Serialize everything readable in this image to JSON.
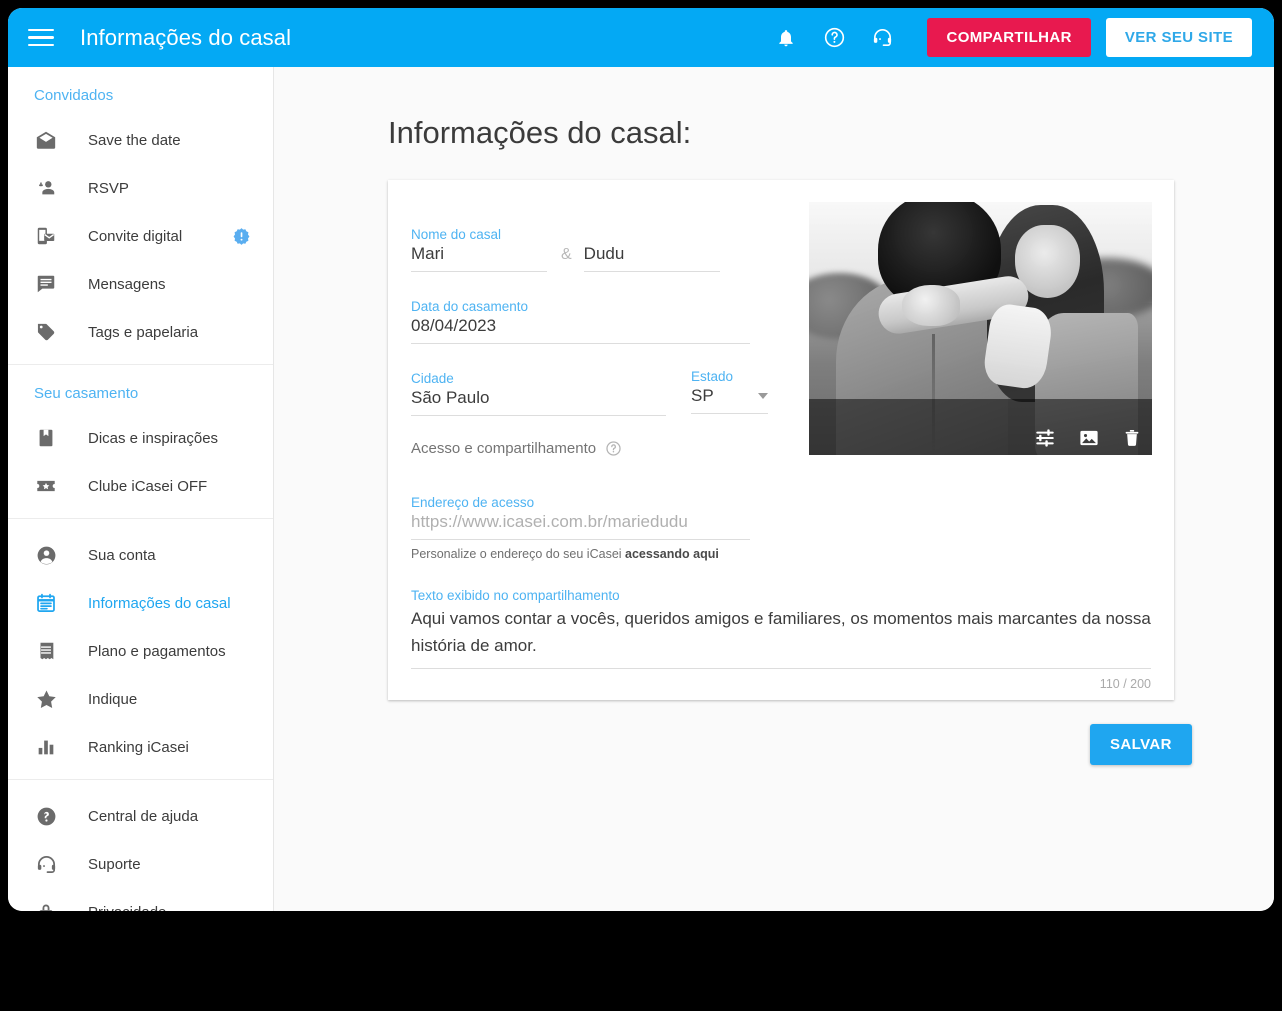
{
  "topbar": {
    "title": "Informações do casal",
    "menu_icon": "hamburger-menu-icon",
    "icons": [
      {
        "name": "notifications-bell-icon",
        "glyph": "bell"
      },
      {
        "name": "help-circle-icon",
        "glyph": "question"
      },
      {
        "name": "support-headset-icon",
        "glyph": "headset"
      }
    ],
    "share_label": "COMPARTILHAR",
    "site_label": "VER SEU SITE",
    "share_color": "#e8194f",
    "bar_color": "#04a9f4",
    "site_text_color": "#2fa8e8"
  },
  "sidebar": {
    "groups": [
      {
        "header": "Convidados",
        "items": [
          {
            "label": "Save the date",
            "icon": "mail-open-icon",
            "active": false,
            "badge": null
          },
          {
            "label": "RSVP",
            "icon": "person-add-icon",
            "active": false,
            "badge": null
          },
          {
            "label": "Convite digital",
            "icon": "mobile-invite-icon",
            "active": false,
            "badge": "!"
          },
          {
            "label": "Mensagens",
            "icon": "message-icon",
            "active": false,
            "badge": null
          },
          {
            "label": "Tags e papelaria",
            "icon": "tag-icon",
            "active": false,
            "badge": null
          }
        ]
      },
      {
        "header": "Seu casamento",
        "items": [
          {
            "label": "Dicas e inspirações",
            "icon": "bookmark-book-icon",
            "active": false,
            "badge": null
          },
          {
            "label": "Clube iCasei OFF",
            "icon": "ticket-star-icon",
            "active": false,
            "badge": null
          }
        ]
      },
      {
        "header": "",
        "items": [
          {
            "label": "Sua conta",
            "icon": "account-circle-icon",
            "active": false,
            "badge": null
          },
          {
            "label": "Informações do casal",
            "icon": "calendar-icon",
            "active": true,
            "badge": null
          },
          {
            "label": "Plano e pagamentos",
            "icon": "receipt-icon",
            "active": false,
            "badge": null
          },
          {
            "label": "Indique",
            "icon": "star-icon",
            "active": false,
            "badge": null
          },
          {
            "label": "Ranking iCasei",
            "icon": "bar-chart-icon",
            "active": false,
            "badge": null
          }
        ]
      },
      {
        "header": "",
        "items": [
          {
            "label": "Central de ajuda",
            "icon": "help-filled-icon",
            "active": false,
            "badge": null
          },
          {
            "label": "Suporte",
            "icon": "support-headset-icon",
            "active": false,
            "badge": null
          },
          {
            "label": "Privacidade",
            "icon": "lock-icon",
            "active": false,
            "badge": null
          }
        ]
      }
    ],
    "active_color": "#1fa6f0",
    "header_color": "#4eb3f2"
  },
  "main": {
    "page_title": "Informações do casal:",
    "fields": {
      "couple_name": {
        "label": "Nome do casal",
        "name1": "Mari",
        "name2": "Dudu",
        "separator": "&"
      },
      "wedding_date": {
        "label": "Data do casamento",
        "value": "08/04/2023"
      },
      "city": {
        "label": "Cidade",
        "value": "São Paulo"
      },
      "state": {
        "label": "Estado",
        "value": "SP",
        "caret_icon": "chevron-down-icon"
      },
      "access_section": {
        "label": "Acesso e compartilhamento",
        "help_icon": "help-circle-outline-icon"
      },
      "access_url": {
        "label": "Endereço de acesso",
        "value": "https://www.icasei.com.br/mariedudu",
        "hint_prefix": "Personalize o endereço do seu iCasei ",
        "hint_link": "acessando aqui"
      },
      "share_text": {
        "label": "Texto exibido no compartilhamento",
        "value": "Aqui vamos contar a vocês, queridos amigos e familiares, os momentos mais marcantes da nossa história de amor.",
        "counter": "110 / 200"
      }
    },
    "photo": {
      "alt": "Foto em preto e branco do casal se abraçando em campo aberto",
      "tools": [
        {
          "name": "tune-sliders-icon"
        },
        {
          "name": "image-picture-icon"
        },
        {
          "name": "trash-delete-icon"
        }
      ]
    },
    "save_label": "SALVAR",
    "save_color": "#1fa6f0"
  }
}
